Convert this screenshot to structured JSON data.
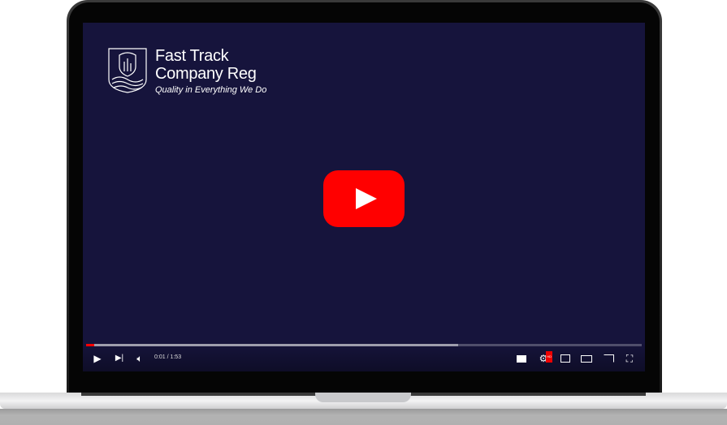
{
  "video": {
    "brand_line1": "Fast Track",
    "brand_line2": "Company Reg",
    "tagline": "Quality in Everything We Do",
    "play_icon": "youtube-play-icon",
    "accent": "#ff0000",
    "background": "#16143c"
  },
  "player": {
    "time": "0:01 / 1:53",
    "played_percent": 1.5,
    "buffered_percent": 67,
    "hd_badge": "HD",
    "icons": [
      "play-icon",
      "next-icon",
      "volume-icon",
      "subtitles-icon",
      "settings-icon",
      "miniplayer-icon",
      "theater-icon",
      "cast-icon",
      "fullscreen-icon"
    ]
  }
}
